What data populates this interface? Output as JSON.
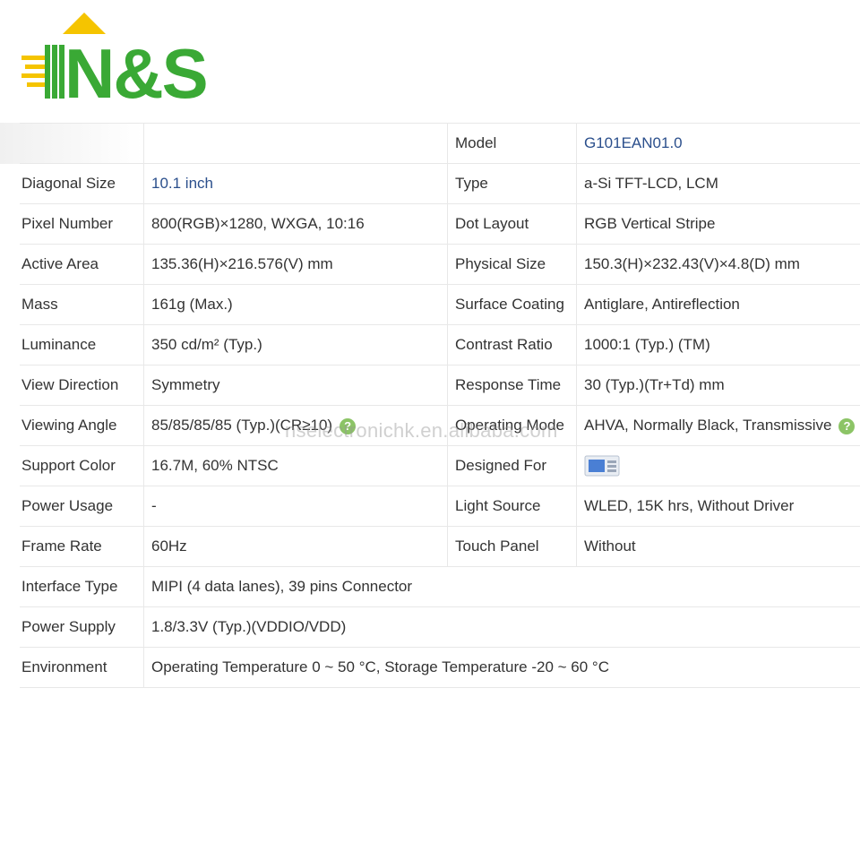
{
  "logo": {
    "text": "N&S"
  },
  "watermark": "nselectronichk.en.alibaba.com",
  "rows": [
    {
      "k1": "",
      "v1": "",
      "k2": "Model",
      "v2": "G101EAN01.0"
    },
    {
      "k1": "Diagonal Size",
      "v1": "10.1 inch",
      "k2": "Type",
      "v2": "a-Si TFT-LCD, LCM"
    },
    {
      "k1": "Pixel Number",
      "v1": "800(RGB)×1280, WXGA, 10:16",
      "k2": "Dot Layout",
      "v2": "RGB Vertical Stripe"
    },
    {
      "k1": "Active Area",
      "v1": "135.36(H)×216.576(V) mm",
      "k2": "Physical Size",
      "v2": "150.3(H)×232.43(V)×4.8(D) mm"
    },
    {
      "k1": "Mass",
      "v1": "161g (Max.)",
      "k2": "Surface Coating",
      "v2": "Antiglare, Antireflection"
    },
    {
      "k1": "Luminance",
      "v1": "350 cd/m² (Typ.)",
      "k2": "Contrast Ratio",
      "v2": "1000:1 (Typ.) (TM)"
    },
    {
      "k1": "View Direction",
      "v1": "Symmetry",
      "k2": "Response Time",
      "v2": "30 (Typ.)(Tr+Td) mm"
    },
    {
      "k1": "Viewing Angle",
      "v1": "85/85/85/85 (Typ.)(CR≥10)",
      "k2": "Operating Mode",
      "v2": "AHVA, Normally Black, Transmissive"
    },
    {
      "k1": "Support Color",
      "v1": "16.7M, 60% NTSC",
      "k2": "Designed For",
      "v2": ""
    },
    {
      "k1": "Power Usage",
      "v1": "-",
      "k2": "Light Source",
      "v2": "WLED, 15K hrs, Without Driver"
    },
    {
      "k1": "Frame Rate",
      "v1": "60Hz",
      "k2": "Touch Panel",
      "v2": "Without"
    },
    {
      "k1": "Interface Type",
      "v1": "MIPI (4 data lanes), 39 pins Connector"
    },
    {
      "k1": "Power Supply",
      "v1": "1.8/3.3V (Typ.)(VDDIO/VDD)"
    },
    {
      "k1": "Environment",
      "v1": "Operating Temperature 0 ~ 50 °C, Storage Temperature -20 ~ 60 °C"
    }
  ],
  "help_glyph": "?",
  "colors": {
    "brand_green": "#3aa935",
    "brand_yellow": "#f5c400",
    "link_blue": "#2b4f8c"
  }
}
